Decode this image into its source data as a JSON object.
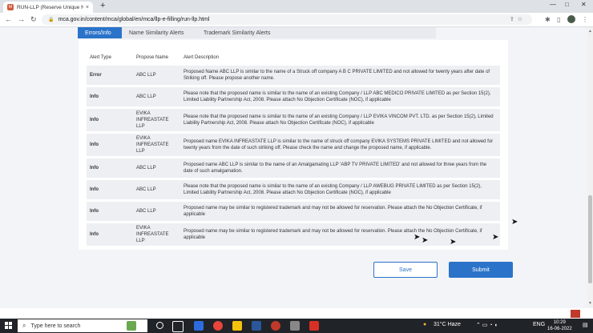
{
  "browser": {
    "tab_title": "RUN-LLP (Reserve Unique Name)",
    "tab_favicon_text": "M",
    "tab_close": "×",
    "new_tab": "+",
    "minimize": "—",
    "maximize": "□",
    "close": "✕",
    "back": "←",
    "forward": "→",
    "reload": "↻",
    "lock": "🔒",
    "url": "mca.gov.in/content/mca/global/en/mca/llp-e-filling/run-llp.html"
  },
  "page": {
    "tabs": [
      {
        "label": "Errors/Info",
        "active": true
      },
      {
        "label": "Name Similarity Alerts",
        "active": false
      },
      {
        "label": "Trademark Similarity Alerts",
        "active": false
      }
    ],
    "table": {
      "headers": [
        "Alert Type",
        "Propose Name",
        "Alert Description"
      ],
      "rows": [
        {
          "type": "Error",
          "name": "ABC LLP",
          "description": "Proposed Name ABC LLP is similar to the name of a Struck off company A B C PRIVATE LIMITED and not allowed for twenty years after date of Striking off. Please propose another name."
        },
        {
          "type": "Info",
          "name": "ABC LLP",
          "description": "Please note that the proposed name is similar to the name of an existing Company / LLP ABC MEDICO PRIVATE LIMITED as per Section 15(2), Limited Liability Partnership Act, 2008. Please attach No Objection Certificate (NOC), if applicable"
        },
        {
          "type": "Info",
          "name": "EVIKA INFREASTATE LLP",
          "description": "Please note that the proposed name is similar to the name of an existing Company / LLP EVIKA VINCOM PVT. LTD. as per Section 15(2), Limited Liability Partnership Act, 2008. Please attach No Objection Certificate (NOC), if applicable"
        },
        {
          "type": "Info",
          "name": "EVIKA INFREASTATE LLP",
          "description": "Proposed name EVIKA INFREASTATE LLP is similar to the name of struck off company EVIKA SYSTEMS PRIVATE LIMITED and not allowed for twenty years from the date of such striking off. Please check the name and change the proposed name, if applicable."
        },
        {
          "type": "Info",
          "name": "ABC LLP",
          "description": "Proposed name ABC LLP is similar to the name of an Amalgamating LLP 'ABP TV PRIVATE LIMITED' and not allowed for three years from the date of such amalgamation."
        },
        {
          "type": "Info",
          "name": "ABC LLP",
          "description": "Please note that the proposed name is similar to the name of an existing Company / LLP AWEBUG PRIVATE LIMITED as per Section 15(2), Limited Liability Partnership Act, 2008. Please attach No Objection Certificate (NOC), if applicable"
        },
        {
          "type": "Info",
          "name": "ABC LLP",
          "description": "Proposed name may be similar to registered trademark and may not be allowed for reservation. Please attach the No Objection Certificate, if applicable"
        },
        {
          "type": "Info",
          "name": "EVIKA INFREASTATE LLP",
          "description": "Proposed name may be similar to registered trademark and may not be allowed for reservation. Please attach the No Objection Certificate, if applicable"
        }
      ]
    },
    "save_label": "Save",
    "submit_label": "Submit"
  },
  "taskbar": {
    "search_placeholder": "Type here to search",
    "weather": "31°C  Haze",
    "lang": "ENG",
    "time": "10:29",
    "date": "16-06-2022"
  },
  "colors": {
    "accent": "#2a73c9",
    "page_bg": "#f3f4f8",
    "row_bg": "#eeeff3",
    "taskbar": "#202327"
  }
}
